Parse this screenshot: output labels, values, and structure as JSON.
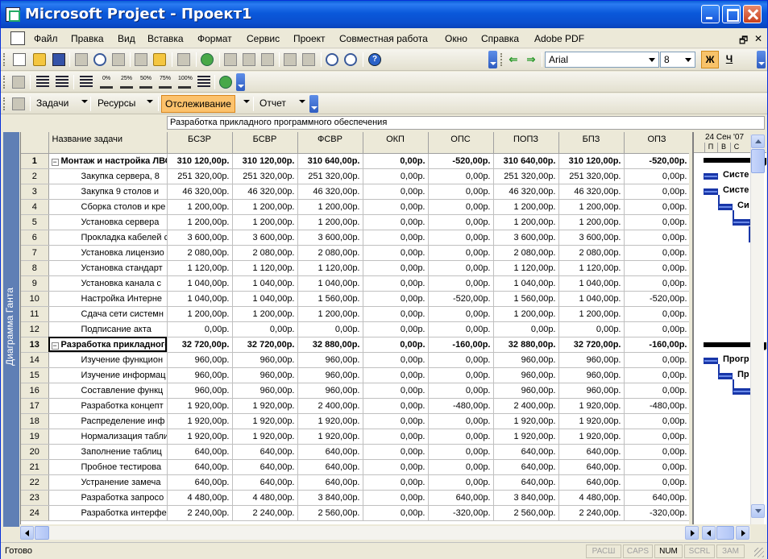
{
  "window": {
    "title": "Microsoft Project - Проект1"
  },
  "menu": [
    "Файл",
    "Правка",
    "Вид",
    "Вставка",
    "Формат",
    "Сервис",
    "Проект",
    "Совместная работа",
    "Окно",
    "Справка",
    "Adobe PDF"
  ],
  "formatting": {
    "font": "Arial",
    "size": "8",
    "bold_label": "Ж",
    "underline_label": "Ч"
  },
  "progress_buttons": [
    "0%",
    "25%",
    "50%",
    "75%",
    "100%"
  ],
  "view_toolbar": {
    "tasks": "Задачи",
    "resources": "Ресурсы",
    "tracking": "Отслеживание",
    "report": "Отчет"
  },
  "entry_bar": {
    "value": "Разработка прикладного программного обеспечения"
  },
  "view_bar": {
    "label": "Диаграмма Ганта"
  },
  "table": {
    "columns": [
      "Название задачи",
      "БСЗР",
      "БСВР",
      "ФСВР",
      "ОКП",
      "ОПС",
      "ПОПЗ",
      "БПЗ",
      "ОПЗ"
    ],
    "rows": [
      {
        "id": "1",
        "summary": true,
        "name": "Монтаж и настройка ЛВС",
        "v": [
          "310 120,00р.",
          "310 120,00р.",
          "310 640,00р.",
          "0,00р.",
          "-520,00р.",
          "310 640,00р.",
          "310 120,00р.",
          "-520,00р."
        ]
      },
      {
        "id": "2",
        "name": "Закупка сервера, 8",
        "v": [
          "251 320,00р.",
          "251 320,00р.",
          "251 320,00р.",
          "0,00р.",
          "0,00р.",
          "251 320,00р.",
          "251 320,00р.",
          "0,00р."
        ]
      },
      {
        "id": "3",
        "name": "Закупка 9 столов и",
        "v": [
          "46 320,00р.",
          "46 320,00р.",
          "46 320,00р.",
          "0,00р.",
          "0,00р.",
          "46 320,00р.",
          "46 320,00р.",
          "0,00р."
        ]
      },
      {
        "id": "4",
        "name": "Сборка столов и кре",
        "v": [
          "1 200,00р.",
          "1 200,00р.",
          "1 200,00р.",
          "0,00р.",
          "0,00р.",
          "1 200,00р.",
          "1 200,00р.",
          "0,00р."
        ]
      },
      {
        "id": "5",
        "name": "Установка сервера",
        "v": [
          "1 200,00р.",
          "1 200,00р.",
          "1 200,00р.",
          "0,00р.",
          "0,00р.",
          "1 200,00р.",
          "1 200,00р.",
          "0,00р."
        ]
      },
      {
        "id": "6",
        "name": "Прокладка кабелей с",
        "v": [
          "3 600,00р.",
          "3 600,00р.",
          "3 600,00р.",
          "0,00р.",
          "0,00р.",
          "3 600,00р.",
          "3 600,00р.",
          "0,00р."
        ]
      },
      {
        "id": "7",
        "name": "Установка лицензио",
        "v": [
          "2 080,00р.",
          "2 080,00р.",
          "2 080,00р.",
          "0,00р.",
          "0,00р.",
          "2 080,00р.",
          "2 080,00р.",
          "0,00р."
        ]
      },
      {
        "id": "8",
        "name": "Установка стандарт",
        "v": [
          "1 120,00р.",
          "1 120,00р.",
          "1 120,00р.",
          "0,00р.",
          "0,00р.",
          "1 120,00р.",
          "1 120,00р.",
          "0,00р."
        ]
      },
      {
        "id": "9",
        "name": "Установка канала с",
        "v": [
          "1 040,00р.",
          "1 040,00р.",
          "1 040,00р.",
          "0,00р.",
          "0,00р.",
          "1 040,00р.",
          "1 040,00р.",
          "0,00р."
        ]
      },
      {
        "id": "10",
        "name": "Настройка Интерне",
        "v": [
          "1 040,00р.",
          "1 040,00р.",
          "1 560,00р.",
          "0,00р.",
          "-520,00р.",
          "1 560,00р.",
          "1 040,00р.",
          "-520,00р."
        ]
      },
      {
        "id": "11",
        "name": "Сдача сети системн",
        "v": [
          "1 200,00р.",
          "1 200,00р.",
          "1 200,00р.",
          "0,00р.",
          "0,00р.",
          "1 200,00р.",
          "1 200,00р.",
          "0,00р."
        ]
      },
      {
        "id": "12",
        "name": "Подписание акта",
        "v": [
          "0,00р.",
          "0,00р.",
          "0,00р.",
          "0,00р.",
          "0,00р.",
          "0,00р.",
          "0,00р.",
          "0,00р."
        ]
      },
      {
        "id": "13",
        "summary": true,
        "selected": true,
        "name": "Разработка прикладного",
        "v": [
          "32 720,00р.",
          "32 720,00р.",
          "32 880,00р.",
          "0,00р.",
          "-160,00р.",
          "32 880,00р.",
          "32 720,00р.",
          "-160,00р."
        ]
      },
      {
        "id": "14",
        "name": "Изучение функцион",
        "v": [
          "960,00р.",
          "960,00р.",
          "960,00р.",
          "0,00р.",
          "0,00р.",
          "960,00р.",
          "960,00р.",
          "0,00р."
        ]
      },
      {
        "id": "15",
        "name": "Изучение информац",
        "v": [
          "960,00р.",
          "960,00р.",
          "960,00р.",
          "0,00р.",
          "0,00р.",
          "960,00р.",
          "960,00р.",
          "0,00р."
        ]
      },
      {
        "id": "16",
        "name": "Составление функц",
        "v": [
          "960,00р.",
          "960,00р.",
          "960,00р.",
          "0,00р.",
          "0,00р.",
          "960,00р.",
          "960,00р.",
          "0,00р."
        ]
      },
      {
        "id": "17",
        "name": "Разработка концепт",
        "v": [
          "1 920,00р.",
          "1 920,00р.",
          "2 400,00р.",
          "0,00р.",
          "-480,00р.",
          "2 400,00р.",
          "1 920,00р.",
          "-480,00р."
        ]
      },
      {
        "id": "18",
        "name": "Распределение инф",
        "v": [
          "1 920,00р.",
          "1 920,00р.",
          "1 920,00р.",
          "0,00р.",
          "0,00р.",
          "1 920,00р.",
          "1 920,00р.",
          "0,00р."
        ]
      },
      {
        "id": "19",
        "name": "Нормализация табли",
        "v": [
          "1 920,00р.",
          "1 920,00р.",
          "1 920,00р.",
          "0,00р.",
          "0,00р.",
          "1 920,00р.",
          "1 920,00р.",
          "0,00р."
        ]
      },
      {
        "id": "20",
        "name": "Заполнение таблиц",
        "v": [
          "640,00р.",
          "640,00р.",
          "640,00р.",
          "0,00р.",
          "0,00р.",
          "640,00р.",
          "640,00р.",
          "0,00р."
        ]
      },
      {
        "id": "21",
        "name": "Пробное тестирова",
        "v": [
          "640,00р.",
          "640,00р.",
          "640,00р.",
          "0,00р.",
          "0,00р.",
          "640,00р.",
          "640,00р.",
          "0,00р."
        ]
      },
      {
        "id": "22",
        "name": "Устранение замеча",
        "v": [
          "640,00р.",
          "640,00р.",
          "640,00р.",
          "0,00р.",
          "0,00р.",
          "640,00р.",
          "640,00р.",
          "0,00р."
        ]
      },
      {
        "id": "23",
        "name": "Разработка запросо",
        "v": [
          "4 480,00р.",
          "4 480,00р.",
          "3 840,00р.",
          "0,00р.",
          "640,00р.",
          "3 840,00р.",
          "4 480,00р.",
          "640,00р."
        ]
      },
      {
        "id": "24",
        "name": "Разработка интерфе",
        "v": [
          "2 240,00р.",
          "2 240,00р.",
          "2 560,00р.",
          "0,00р.",
          "-320,00р.",
          "2 560,00р.",
          "2 240,00р.",
          "-320,00р."
        ]
      }
    ]
  },
  "gantt": {
    "week_label": "24 Сен '07",
    "days": [
      "П",
      "В",
      "С"
    ],
    "labels": [
      "Систе",
      "Систе",
      "Си",
      "Прогр",
      "Пр"
    ]
  },
  "status": {
    "text": "Готово",
    "indicators": [
      "РАСШ",
      "CAPS",
      "NUM",
      "SCRL",
      "ЗАМ"
    ],
    "active": "NUM"
  }
}
